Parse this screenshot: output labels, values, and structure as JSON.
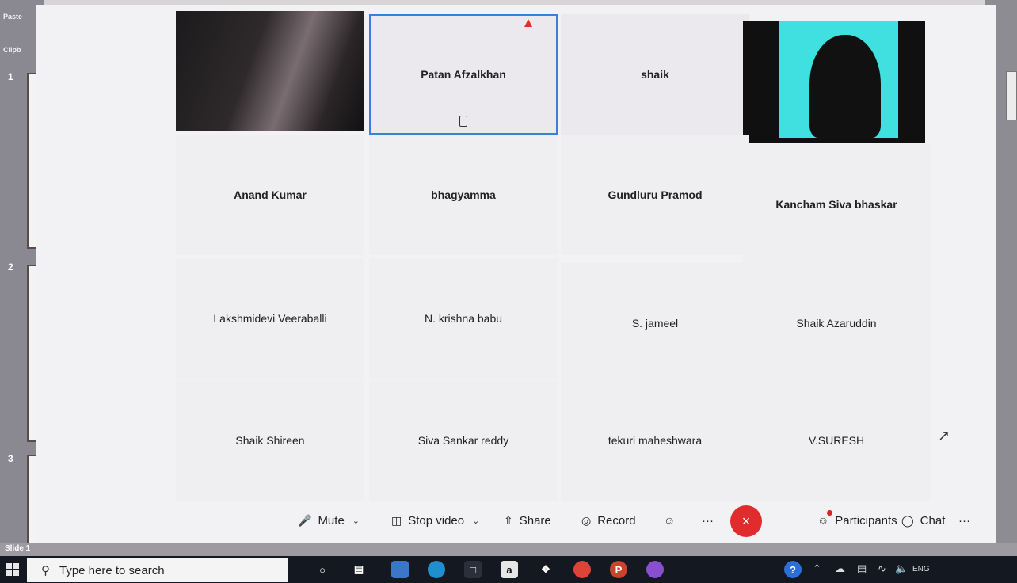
{
  "ppt": {
    "clipboard_top": "Paste",
    "clipboard_label": "Clipb",
    "slide_numbers": [
      "1",
      "2",
      "3"
    ],
    "status_slide": "Slide 1"
  },
  "meeting": {
    "tiles": [
      {
        "name": ""
      },
      {
        "name": "Patan Afzalkhan"
      },
      {
        "name": "shaik"
      },
      {
        "name": ""
      },
      {
        "name": "Anand Kumar"
      },
      {
        "name": "bhagyamma"
      },
      {
        "name": "Gundluru Pramod"
      },
      {
        "name": "Kancham Siva bhaskar"
      },
      {
        "name": "Lakshmidevi Veeraballi"
      },
      {
        "name": "N. krishna babu"
      },
      {
        "name": "S. jameel"
      },
      {
        "name": "Shaik Azaruddin"
      },
      {
        "name": "Shaik Shireen"
      },
      {
        "name": "Siva Sankar reddy"
      },
      {
        "name": "tekuri maheshwara"
      },
      {
        "name": "V.SURESH"
      }
    ]
  },
  "toolbar": {
    "mute_label": "Mute",
    "stop_video_label": "Stop video",
    "share_label": "Share",
    "record_label": "Record",
    "participants_label": "Participants",
    "chat_label": "Chat",
    "more_label": "···",
    "end_label": "×"
  },
  "taskbar": {
    "search_placeholder": "Type here to search",
    "lang": "ENG"
  },
  "colors": {
    "end_call": "#e02c2c",
    "selected_border": "#3a7fd9",
    "taskbar": "#141821"
  }
}
